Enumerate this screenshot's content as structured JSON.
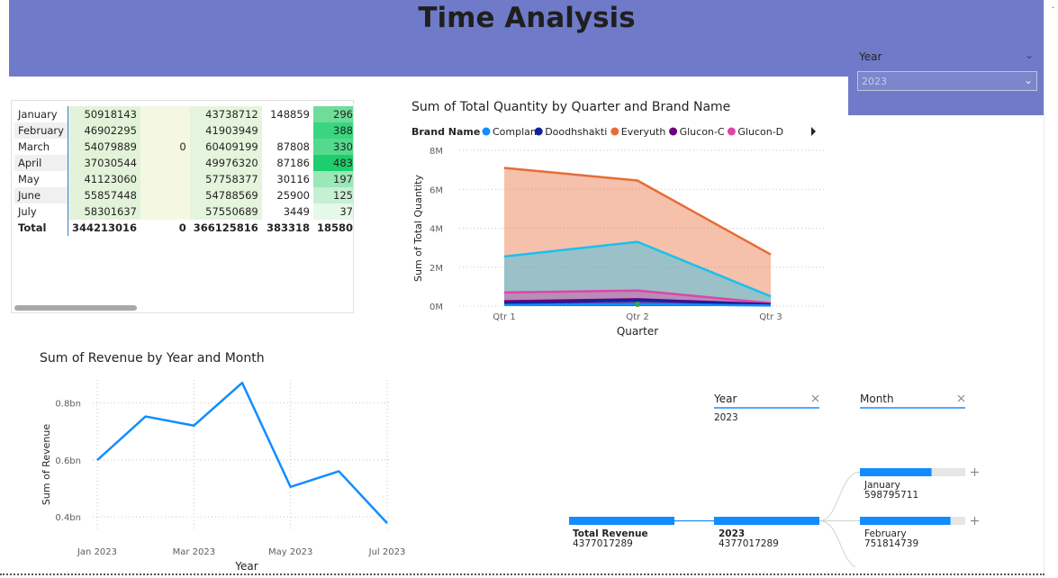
{
  "header": {
    "title": "Time Analysis",
    "background_color": "#6f7bc8"
  },
  "year_slicer": {
    "label": "Year",
    "value": "2023",
    "icon": "chevron-down-icon"
  },
  "matrix": {
    "rows": [
      {
        "month": "January",
        "values": [
          "50918143",
          "",
          "43738712",
          "148859",
          "296"
        ]
      },
      {
        "month": "February",
        "values": [
          "46902295",
          "",
          "41903949",
          "",
          "388"
        ]
      },
      {
        "month": "March",
        "values": [
          "54079889",
          "0",
          "60409199",
          "87808",
          "330"
        ]
      },
      {
        "month": "April",
        "values": [
          "37030544",
          "",
          "49976320",
          "87186",
          "483"
        ]
      },
      {
        "month": "May",
        "values": [
          "41123060",
          "",
          "57758377",
          "30116",
          "197"
        ]
      },
      {
        "month": "June",
        "values": [
          "55857448",
          "",
          "54788569",
          "25900",
          "125"
        ]
      },
      {
        "month": "July",
        "values": [
          "58301637",
          "",
          "57550689",
          "3449",
          "37"
        ]
      }
    ],
    "total": {
      "label": "Total",
      "values": [
        "344213016",
        "0",
        "366125816",
        "383318",
        "18580"
      ]
    },
    "last_column_colors": [
      "#6fdc9a",
      "#3ad67f",
      "#55d98d",
      "#1ccf6c",
      "#9ae7b7",
      "#c6f0d4",
      "#e6f8ea"
    ]
  },
  "area_chart": {
    "title": "Sum of Total Quantity by Quarter and Brand Name",
    "legend_title": "Brand Name",
    "legend_more_icon": "play-right-icon",
    "chart_data": {
      "type": "area",
      "xlabel": "Quarter",
      "ylabel": "Sum of Total Quantity",
      "categories": [
        "Qtr 1",
        "Qtr 2",
        "Qtr 3"
      ],
      "y_ticks": [
        "0M",
        "2M",
        "4M",
        "6M",
        "8M"
      ],
      "ylim": [
        0,
        8000000
      ],
      "grid": true,
      "legend_position": "top",
      "series": [
        {
          "name": "Complan",
          "color": "#118dff",
          "values": [
            60000,
            100000,
            30000
          ]
        },
        {
          "name": "Doodhshakti",
          "color": "#12239e",
          "values": [
            150000,
            300000,
            80000
          ]
        },
        {
          "name": "Everyuth",
          "color": "#e66c37",
          "values": [
            7100000,
            6450000,
            2650000
          ]
        },
        {
          "name": "Glucon-C",
          "color": "#6b007b",
          "values": [
            250000,
            350000,
            100000
          ]
        },
        {
          "name": "Glucon-D",
          "color": "#e044a7",
          "values": [
            700000,
            800000,
            150000
          ]
        },
        {
          "name": "",
          "color": "#1ac0ef",
          "values": [
            2550000,
            3300000,
            500000
          ]
        }
      ]
    }
  },
  "line_chart": {
    "title": "Sum of Revenue by Year and Month",
    "chart_data": {
      "type": "line",
      "xlabel": "Year",
      "ylabel": "Sum of Revenue",
      "x_ticks": [
        "Jan 2023",
        "Mar 2023",
        "May 2023",
        "Jul 2023"
      ],
      "y_ticks": [
        "0.4bn",
        "0.6bn",
        "0.8bn"
      ],
      "ylim": [
        0.35,
        0.88
      ],
      "grid": true,
      "series": [
        {
          "name": "",
          "color": "#118dff",
          "x": [
            "Jan 2023",
            "Feb 2023",
            "Mar 2023",
            "Apr 2023",
            "May 2023",
            "Jun 2023",
            "Jul 2023"
          ],
          "values": [
            0.599,
            0.752,
            0.72,
            0.87,
            0.505,
            0.56,
            0.378
          ]
        }
      ]
    }
  },
  "decomposition_tree": {
    "levels": [
      {
        "label": "Year",
        "value": "2023",
        "close_icon": "close-icon"
      },
      {
        "label": "Month",
        "value": "",
        "close_icon": "close-icon"
      }
    ],
    "root": {
      "label": "Total Revenue",
      "value": "4377017289"
    },
    "year_node": {
      "label": "2023",
      "value": "4377017289"
    },
    "month_nodes": [
      {
        "label": "January",
        "value": "598795711",
        "fraction": 0.68
      },
      {
        "label": "February",
        "value": "751814739",
        "fraction": 0.86
      }
    ],
    "expand_icon": "plus-icon",
    "bar_color": "#118dff"
  }
}
